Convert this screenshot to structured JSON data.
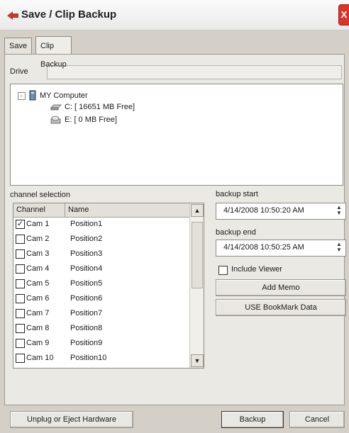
{
  "window": {
    "title": "Save / Clip Backup",
    "close_glyph": "X"
  },
  "tabs": [
    {
      "label": "Save",
      "active": false
    },
    {
      "label": "Clip Backup",
      "active": true
    }
  ],
  "drive": {
    "label": "Drive",
    "value": ""
  },
  "tree": {
    "root": {
      "label": "MY Computer",
      "expander": "-",
      "icon": "computer-icon"
    },
    "drives": [
      {
        "label": "C: [ 16651 MB Free]",
        "icon": "hard-drive-icon"
      },
      {
        "label": "E: [ 0 MB Free]",
        "icon": "cd-drive-icon"
      }
    ]
  },
  "channel_selection": {
    "label": "channel selection",
    "columns": [
      "Channel",
      "Name"
    ],
    "rows": [
      {
        "channel": "Cam 1",
        "name": "Position1",
        "checked": true
      },
      {
        "channel": "Cam 2",
        "name": "Position2",
        "checked": false
      },
      {
        "channel": "Cam 3",
        "name": "Position3",
        "checked": false
      },
      {
        "channel": "Cam 4",
        "name": "Position4",
        "checked": false
      },
      {
        "channel": "Cam 5",
        "name": "Position5",
        "checked": false
      },
      {
        "channel": "Cam 6",
        "name": "Position6",
        "checked": false
      },
      {
        "channel": "Cam 7",
        "name": "Position7",
        "checked": false
      },
      {
        "channel": "Cam 8",
        "name": "Position8",
        "checked": false
      },
      {
        "channel": "Cam 9",
        "name": "Position9",
        "checked": false
      },
      {
        "channel": "Cam 10",
        "name": "Position10",
        "checked": false
      }
    ],
    "check_glyph": "✓",
    "scroll_up_glyph": "▲",
    "scroll_down_glyph": "▼"
  },
  "backup_start": {
    "label": "backup start",
    "value": "4/14/2008 10:50:20 AM"
  },
  "backup_end": {
    "label": "backup end",
    "value": "4/14/2008 10:50:25 AM"
  },
  "spin_glyphs": {
    "up": "▲",
    "down": "▼"
  },
  "include_viewer": {
    "label": "Include Viewer",
    "checked": false
  },
  "buttons": {
    "add_memo": "Add Memo",
    "use_bookmark": "USE BookMark Data",
    "unplug": "Unplug or Eject Hardware",
    "backup": "Backup",
    "cancel": "Cancel"
  },
  "colors": {
    "title_icon": "#c0392b",
    "close_button": "#d7362b"
  }
}
